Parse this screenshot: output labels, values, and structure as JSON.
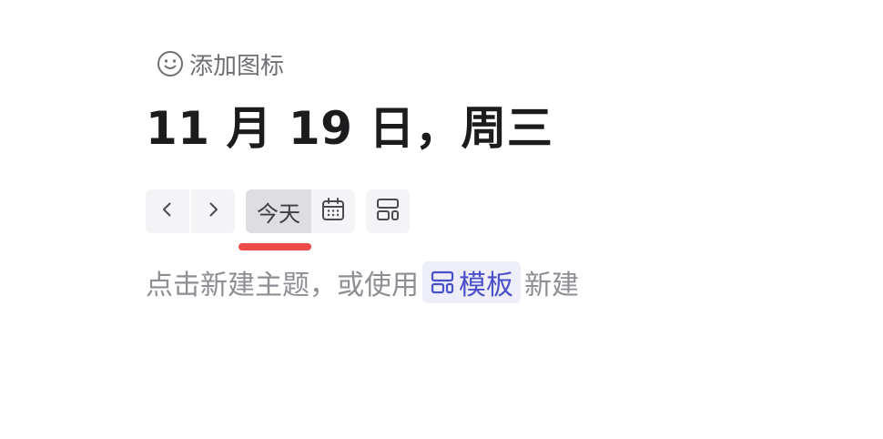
{
  "header": {
    "add_icon_label": "添加图标",
    "title": "11 月 19 日，周三"
  },
  "toolbar": {
    "prev_icon": "chevron-left-icon",
    "next_icon": "chevron-right-icon",
    "today_label": "今天",
    "calendar_icon": "calendar-icon",
    "layout_icon": "layout-icon",
    "highlight_color": "#ef4a4a"
  },
  "hint": {
    "prefix": "点击新建主题，或使用",
    "template_label": "模板",
    "template_icon": "template-icon",
    "suffix": "新建"
  }
}
